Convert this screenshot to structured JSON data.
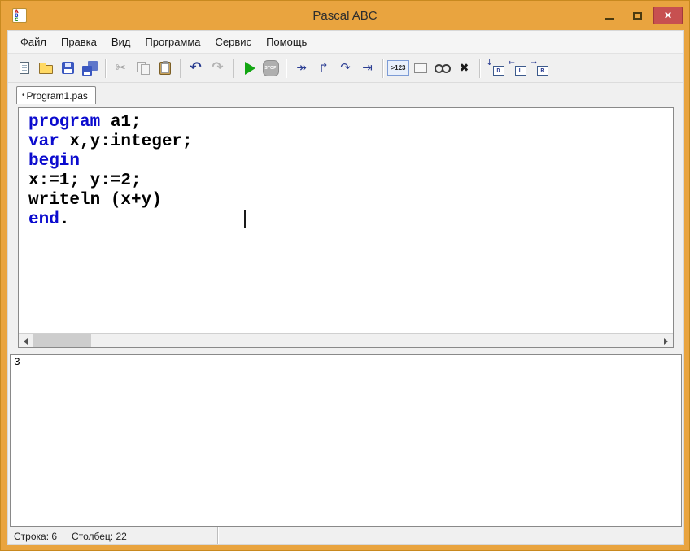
{
  "window": {
    "title": "Pascal ABC",
    "icon": {
      "letters": [
        "A",
        "B",
        "C"
      ]
    },
    "controls": {
      "close": "✕"
    }
  },
  "menu": {
    "items": [
      "Файл",
      "Правка",
      "Вид",
      "Программа",
      "Сервис",
      "Помощь"
    ]
  },
  "toolbar": {
    "stop_label": "STOP",
    "output_toggle_label": ">123",
    "panel_buttons": [
      {
        "label": "D"
      },
      {
        "label": "L"
      },
      {
        "label": "R"
      }
    ]
  },
  "tabs": [
    {
      "marker": "•",
      "label": "Program1.pas"
    }
  ],
  "editor": {
    "lines": [
      {
        "segments": [
          {
            "text": "program",
            "kw": true
          },
          {
            "text": " a1;",
            "kw": false
          }
        ]
      },
      {
        "segments": [
          {
            "text": "var",
            "kw": true
          },
          {
            "text": " x,y:integer;",
            "kw": false
          }
        ]
      },
      {
        "segments": [
          {
            "text": "begin",
            "kw": true
          }
        ]
      },
      {
        "segments": [
          {
            "text": "x:=1; y:=2;",
            "kw": false
          }
        ]
      },
      {
        "segments": [
          {
            "text": "writeln (x+y)",
            "kw": false
          }
        ]
      },
      {
        "segments": [
          {
            "text": "end",
            "kw": true
          },
          {
            "text": ".",
            "kw": false
          }
        ]
      }
    ],
    "caret": {
      "line": 6,
      "column": 22
    }
  },
  "output": {
    "text": "3"
  },
  "statusbar": {
    "line": "Строка: 6",
    "column": "Столбец: 22"
  }
}
